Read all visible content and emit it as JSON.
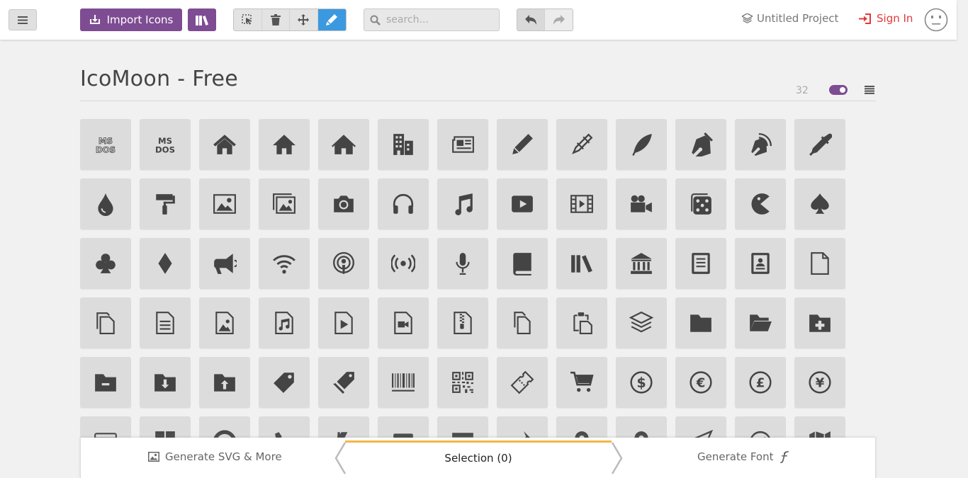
{
  "header": {
    "import_label": "Import Icons",
    "search_placeholder": "search...",
    "project_name": "Untitled Project",
    "signin_label": "Sign In"
  },
  "icon_set": {
    "title": "IcoMoon - Free",
    "count": "32",
    "icons": [
      [
        "ms-dos-outline",
        "ms-dos",
        "home",
        "home2",
        "home3",
        "office",
        "newspaper",
        "pencil",
        "pencil2",
        "quill",
        "pen",
        "blog",
        "eyedropper"
      ],
      [
        "droplet",
        "paint-format",
        "image",
        "images",
        "camera",
        "headphones",
        "music",
        "play",
        "film",
        "video-camera",
        "dice",
        "pacman",
        "spades"
      ],
      [
        "clubs",
        "diamonds",
        "bullhorn",
        "connection",
        "podcast",
        "feed",
        "mic",
        "book",
        "books",
        "library",
        "file-text",
        "profile",
        "file-empty"
      ],
      [
        "files-empty",
        "file-text2",
        "file-picture",
        "file-music",
        "file-play",
        "file-video",
        "file-zip",
        "copy",
        "paste",
        "stack",
        "folder",
        "folder-open",
        "folder-plus"
      ],
      [
        "folder-minus",
        "folder-download",
        "folder-upload",
        "price-tag",
        "price-tags",
        "barcode",
        "qrcode",
        "ticket",
        "cart",
        "coin-dollar",
        "coin-euro",
        "coin-pound",
        "coin-yen"
      ],
      [
        "credit-card",
        "calculator",
        "lifebuoy",
        "phone",
        "address-book",
        "contact",
        "envelop",
        "pushpin",
        "location",
        "location2",
        "compass",
        "compass2",
        "map"
      ]
    ]
  },
  "bottom_bar": {
    "generate_svg": "Generate SVG & More",
    "selection": "Selection (0)",
    "generate_font": "Generate Font"
  },
  "colors": {
    "accent_purple": "#7e4c92",
    "active_blue": "#3b99e0",
    "signin_red": "#e2393c",
    "selection_bar": "#f6b445",
    "icon_fill": "#444444",
    "tile_bg": "#dcdcdc"
  }
}
